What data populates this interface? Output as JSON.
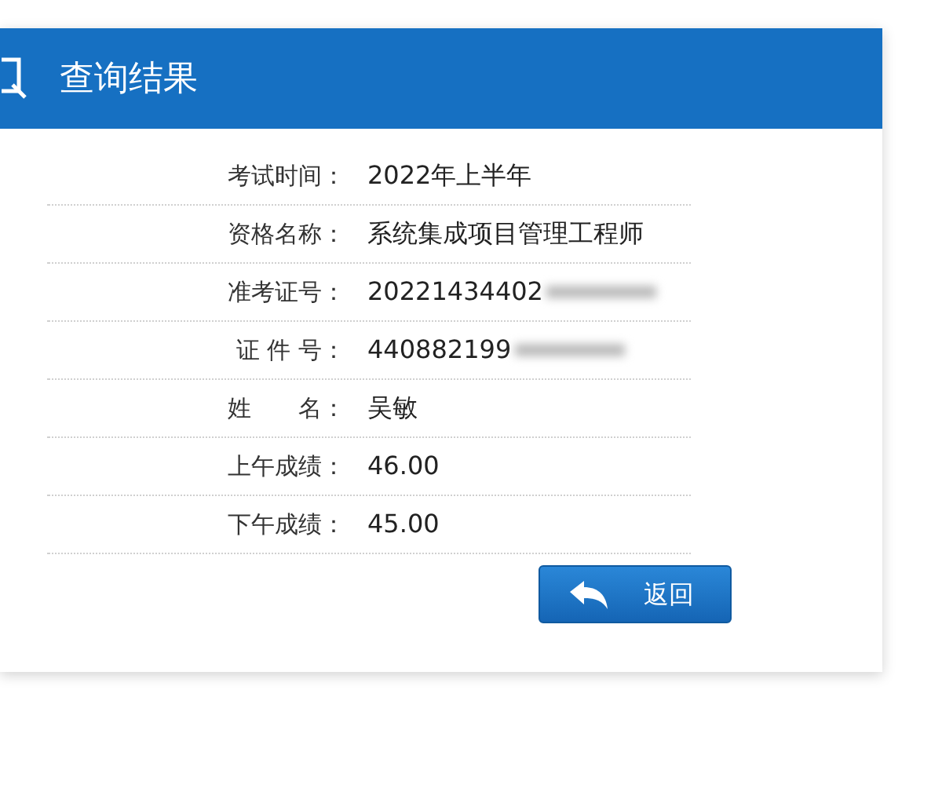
{
  "header": {
    "title": "查询结果"
  },
  "rows": [
    {
      "label": "考试时间：",
      "value": "2022年上半年",
      "redacted": false
    },
    {
      "label": "资格名称：",
      "value": "系统集成项目管理工程师",
      "redacted": false
    },
    {
      "label": "准考证号：",
      "value": "20221434402",
      "redacted": true
    },
    {
      "label": "证 件 号：",
      "value": "440882199",
      "redacted": true
    },
    {
      "label": "姓　　名：",
      "value": "吴敏",
      "redacted": false
    },
    {
      "label": "上午成绩：",
      "value": "46.00",
      "redacted": false
    },
    {
      "label": "下午成绩：",
      "value": "45.00",
      "redacted": false
    }
  ],
  "button": {
    "label": "返回"
  }
}
